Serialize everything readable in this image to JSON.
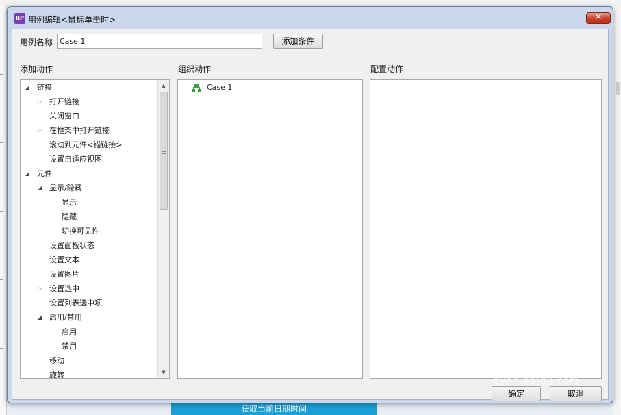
{
  "background": {
    "bottom_button_label": "获取当前日期时间"
  },
  "dialog": {
    "app_icon_text": "RP",
    "title": "用例编辑<鼠标单击时>",
    "close_glyph": "✕",
    "case_name_label": "用例名称",
    "case_name_value": "Case 1",
    "add_condition_button": "添加条件",
    "ok_button": "确定",
    "cancel_button": "取消"
  },
  "panels": {
    "add_action_heading": "添加动作",
    "organize_action_heading": "组织动作",
    "configure_action_heading": "配置动作"
  },
  "action_tree": [
    {
      "label": "链接",
      "level": 0,
      "toggle": "open"
    },
    {
      "label": "打开链接",
      "level": 1,
      "toggle": "closed"
    },
    {
      "label": "关闭窗口",
      "level": 1,
      "toggle": "none"
    },
    {
      "label": "在框架中打开链接",
      "level": 1,
      "toggle": "closed"
    },
    {
      "label": "滚动到元件<锚链接>",
      "level": 1,
      "toggle": "none"
    },
    {
      "label": "设置自适应视图",
      "level": 1,
      "toggle": "none"
    },
    {
      "label": "元件",
      "level": 0,
      "toggle": "open"
    },
    {
      "label": "显示/隐藏",
      "level": 1,
      "toggle": "open"
    },
    {
      "label": "显示",
      "level": 2,
      "toggle": "none"
    },
    {
      "label": "隐藏",
      "level": 2,
      "toggle": "none"
    },
    {
      "label": "切换可见性",
      "level": 2,
      "toggle": "none"
    },
    {
      "label": "设置面板状态",
      "level": 1,
      "toggle": "none"
    },
    {
      "label": "设置文本",
      "level": 1,
      "toggle": "none"
    },
    {
      "label": "设置图片",
      "level": 1,
      "toggle": "none"
    },
    {
      "label": "设置选中",
      "level": 1,
      "toggle": "closed"
    },
    {
      "label": "设置列表选中项",
      "level": 1,
      "toggle": "none"
    },
    {
      "label": "启用/禁用",
      "level": 1,
      "toggle": "open"
    },
    {
      "label": "启用",
      "level": 2,
      "toggle": "none"
    },
    {
      "label": "禁用",
      "level": 2,
      "toggle": "none"
    },
    {
      "label": "移动",
      "level": 1,
      "toggle": "none"
    },
    {
      "label": "旋转",
      "level": 1,
      "toggle": "none"
    }
  ],
  "organize_tree": [
    {
      "label": "Case 1",
      "icon": "case-tree-icon"
    }
  ],
  "watermark": "gyan.baidu.com"
}
